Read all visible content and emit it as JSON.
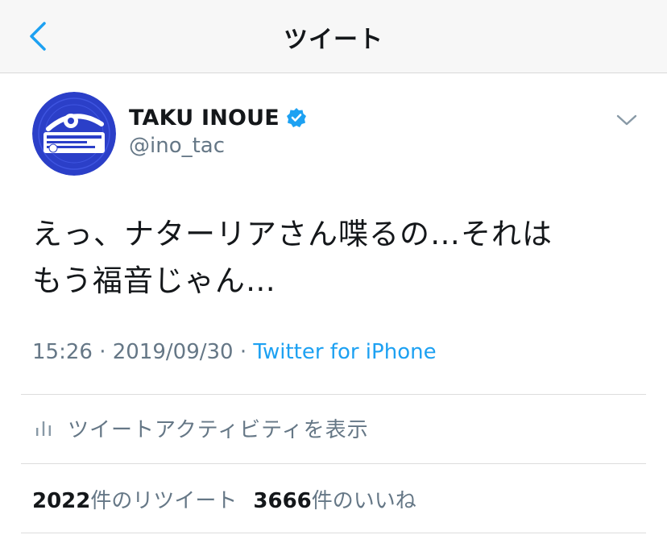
{
  "header": {
    "title": "ツイート",
    "back_icon": "chevron-left-icon",
    "accent_color": "#1da1f2"
  },
  "author": {
    "display_name": "TAKU INOUE",
    "handle": "@ino_tac",
    "verified": true,
    "verified_icon": "verified-badge-icon",
    "avatar_icon": "avatar-record-label-icon",
    "avatar_color": "#2b3fc8"
  },
  "tweet": {
    "text": "えっ、ナターリアさん喋るの…それは\nもう福音じゃん…",
    "time": "15:26",
    "separator1": " · ",
    "date": "2019/09/30",
    "separator2": " · ",
    "source": "Twitter for iPhone"
  },
  "menu": {
    "caret_icon": "chevron-down-icon"
  },
  "activity": {
    "icon": "bar-chart-icon",
    "label": "ツイートアクティビティを表示"
  },
  "stats": {
    "retweets_count": "2022",
    "retweets_label": "件のリツイート",
    "likes_count": "3666",
    "likes_label": "件のいいね"
  }
}
